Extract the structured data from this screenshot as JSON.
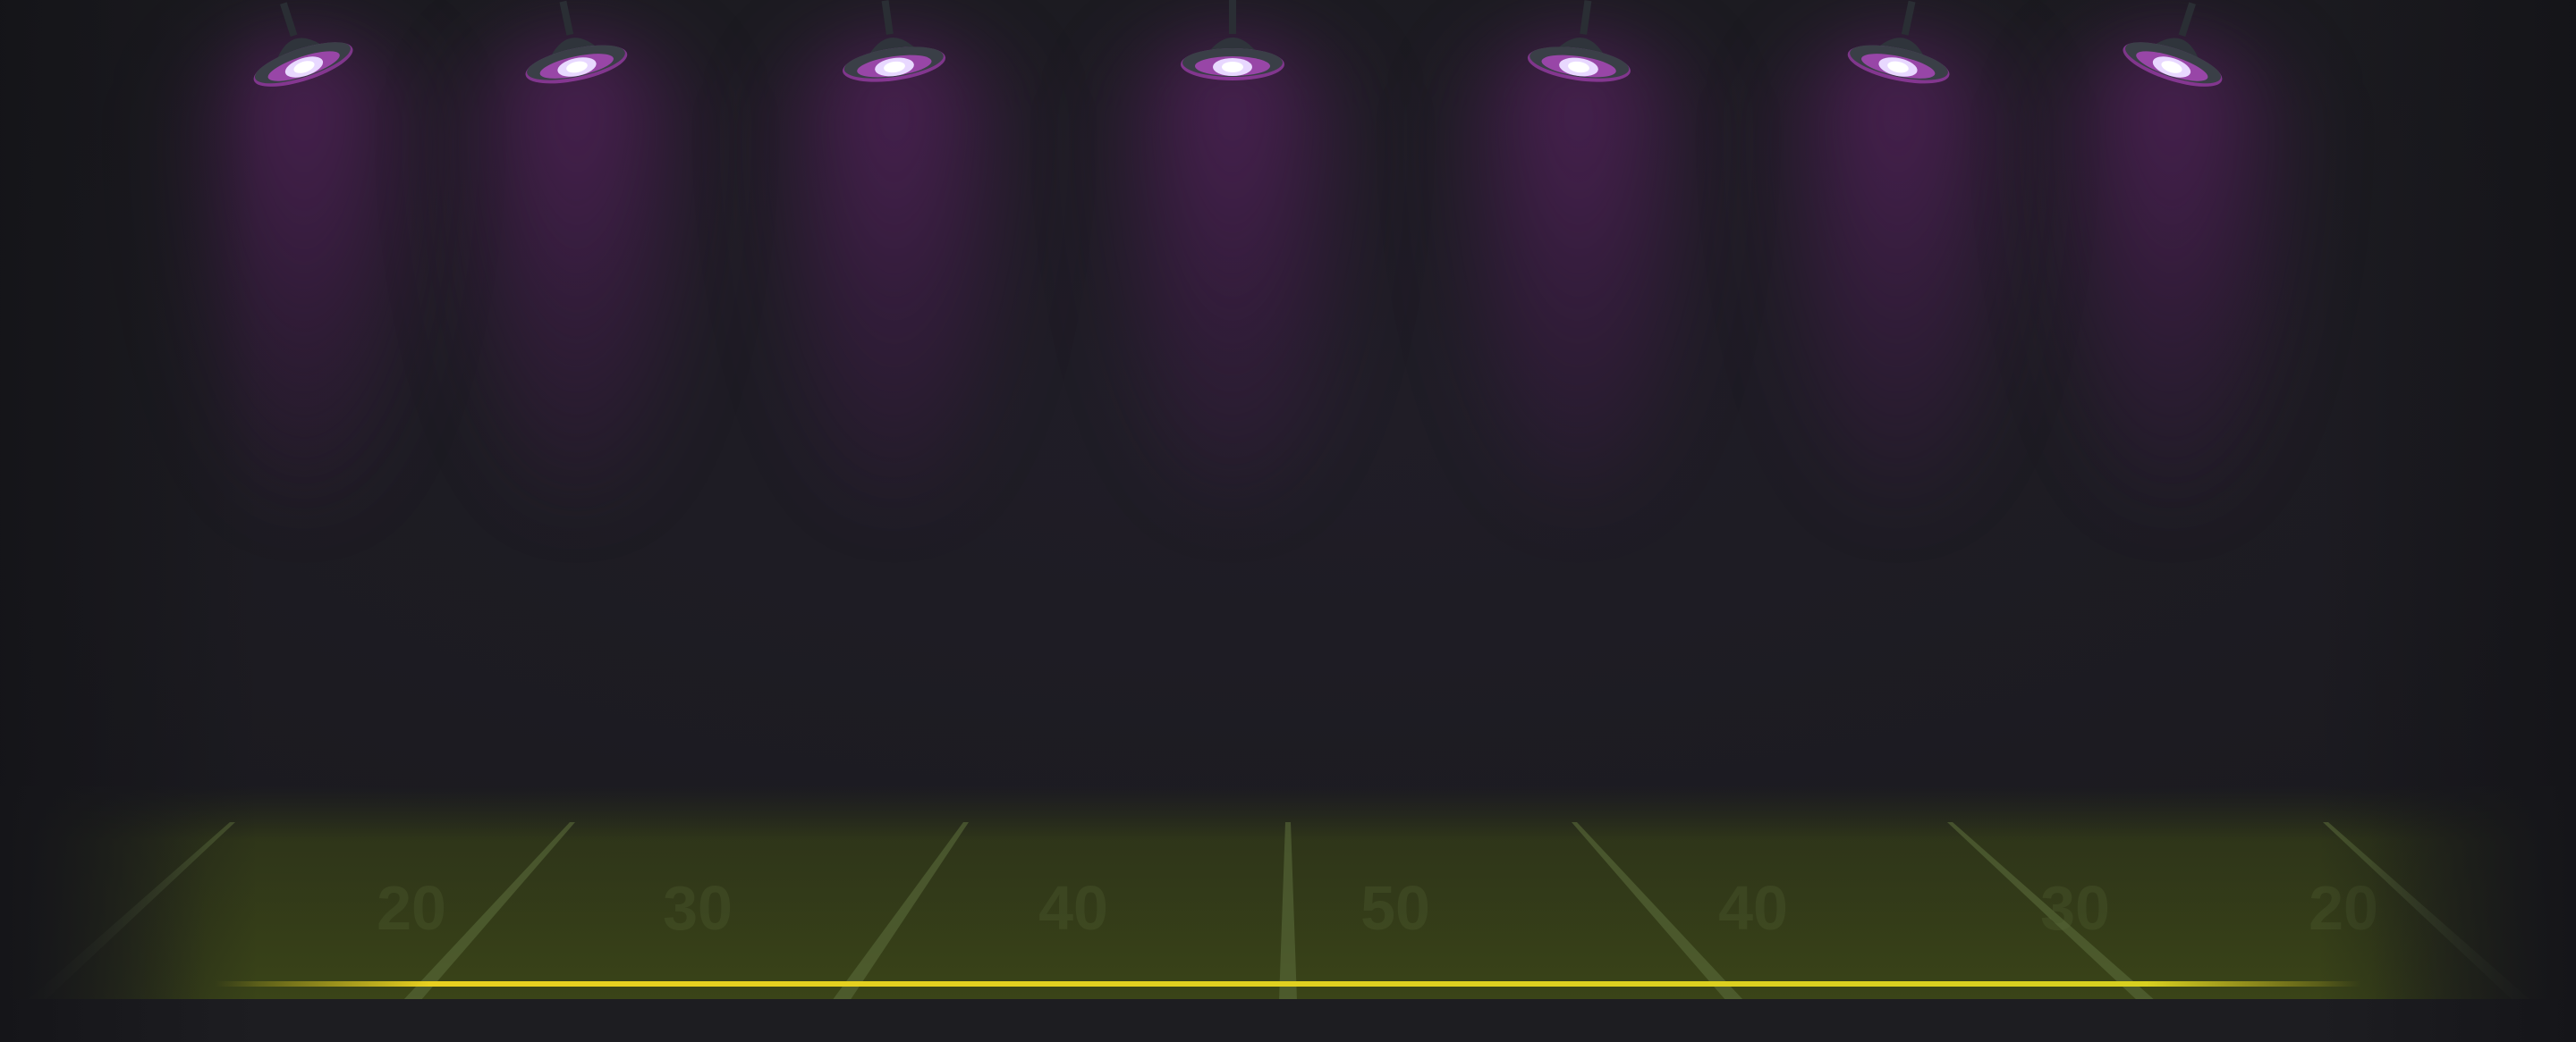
{
  "scene": {
    "background": "#1c1b21",
    "beam_color": "#6a2a7a",
    "lamp_glow": "#e8d8ff",
    "lamp_rim": "#c04ad0",
    "field_color": "#3a4a1a",
    "field_line_color": "#5a6a3a",
    "stripe_color": "#e8d020",
    "lamp_count": 7,
    "field_numbers": [
      "20",
      "30",
      "40",
      "50",
      "40",
      "30",
      "20"
    ]
  }
}
